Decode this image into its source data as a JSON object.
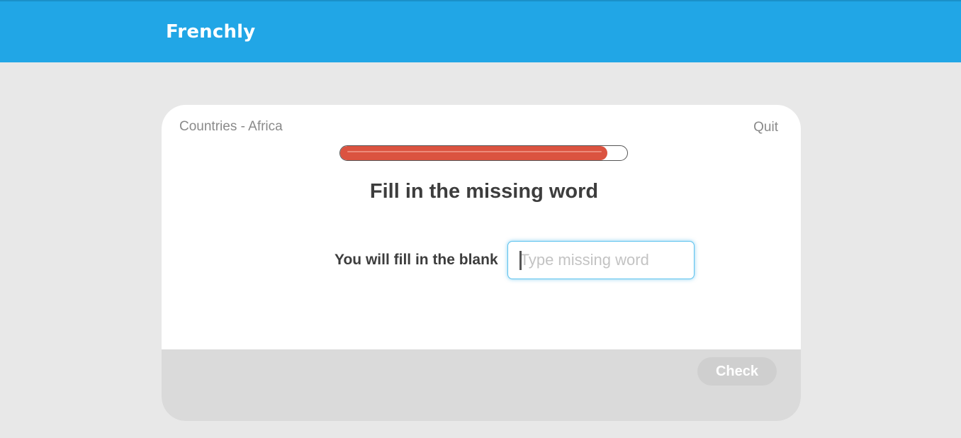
{
  "header": {
    "brand": "Frenchly"
  },
  "lesson": {
    "name": "Countries - Africa",
    "quit_label": "Quit",
    "progress": 0.93
  },
  "question": {
    "title": "Fill in the missing word",
    "sentence": "You will fill in the blank",
    "input_value": "",
    "input_placeholder": "Type missing word"
  },
  "footer": {
    "check_label": "Check"
  },
  "colors": {
    "header": "#21a6e6",
    "progress_fill": "#db5340",
    "input_focus": "#5fc3ee",
    "button_disabled": "#cfcfcf"
  }
}
